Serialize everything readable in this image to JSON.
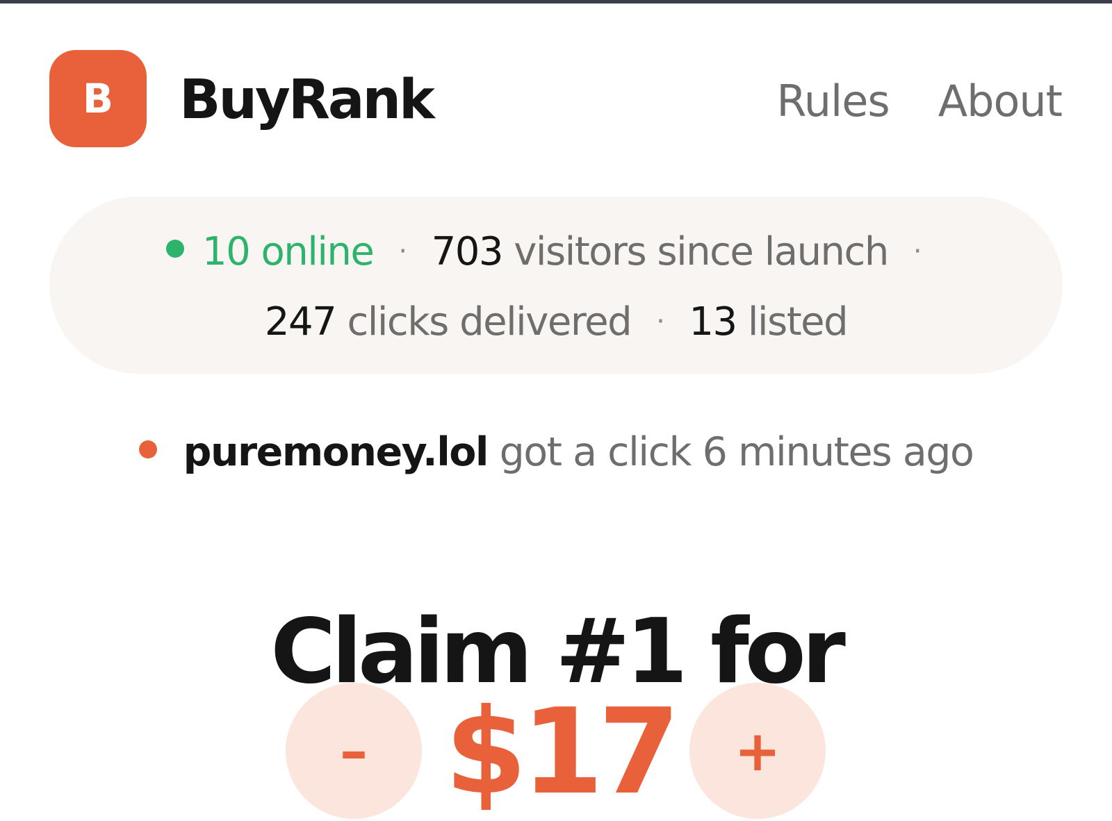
{
  "header": {
    "logo_letter": "B",
    "brand": "BuyRank",
    "nav": [
      {
        "label": "Rules"
      },
      {
        "label": "About"
      }
    ]
  },
  "stats": {
    "online_count": "10",
    "online_label": "online",
    "visitors_count": "703",
    "visitors_label": "visitors since launch",
    "clicks_count": "247",
    "clicks_label": "clicks delivered",
    "listed_count": "13",
    "listed_label": "listed",
    "separator": "·"
  },
  "activity": {
    "site": "puremoney.lol",
    "text": "got a click 6 minutes ago"
  },
  "claim": {
    "title": "Claim #1 for",
    "price": "$17",
    "minus_label": "–",
    "plus_label": "+"
  },
  "colors": {
    "accent": "#e8613b",
    "online": "#2db46c",
    "pill_bg": "#f8f5f2",
    "stepper_bg": "#fbe5dc"
  }
}
